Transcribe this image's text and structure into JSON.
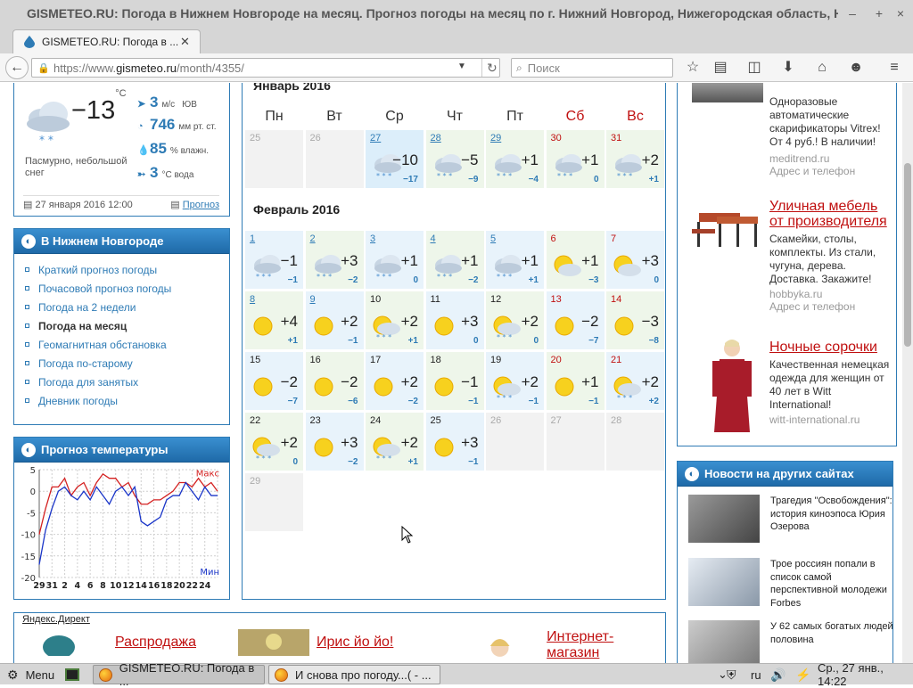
{
  "window": {
    "title": "GISMETEO.RU: Погода в Нижнем Новгороде на месяц. Прогноз погоды на месяц по г. Нижний Новгород, Нижегородская область, Н"
  },
  "tab": {
    "label": "GISMETEO.RU: Погода в ..."
  },
  "url": {
    "prefix": "https://www.",
    "host": "gismeteo.ru",
    "path": "/month/4355/"
  },
  "search": {
    "placeholder": "Поиск"
  },
  "current": {
    "temp": "−13",
    "temp_unit": "°C",
    "condition": "Пасмурно, небольшой снег",
    "wind_value": "3",
    "wind_unit": "м/с",
    "wind_dir": "ЮВ",
    "pressure_value": "746",
    "pressure_unit": "мм рт. ст.",
    "humidity_value": "85",
    "humidity_unit": "% влажн.",
    "water_value": "3",
    "water_unit": "°C вода",
    "date": "27 января 2016 12:00",
    "forecast_link": "Прогноз"
  },
  "city_nav": {
    "title": "В Нижнем Новгороде",
    "items": [
      {
        "label": "Краткий прогноз погоды"
      },
      {
        "label": "Почасовой прогноз погоды"
      },
      {
        "label": "Погода на 2 недели"
      },
      {
        "label": "Погода на месяц"
      },
      {
        "label": "Геомагнитная обстановка"
      },
      {
        "label": "Погода по-старому"
      },
      {
        "label": "Погода для занятых"
      },
      {
        "label": "Дневник погоды"
      }
    ]
  },
  "temp_chart": {
    "title": "Прогноз температуры",
    "max_label": "Макс",
    "min_label": "Мин",
    "chart_data": {
      "type": "line",
      "x": [
        "29",
        "31",
        "2",
        "4",
        "6",
        "8",
        "10",
        "12",
        "14",
        "16",
        "18",
        "20",
        "22",
        "24"
      ],
      "ylim": [
        -20,
        5
      ],
      "yticks": [
        5,
        0,
        -5,
        -10,
        -15,
        -20
      ],
      "series": [
        {
          "name": "Макс",
          "color": "#d42020",
          "values": [
            -10,
            -4,
            1,
            1,
            3,
            -1,
            1,
            2,
            -1,
            2,
            4,
            3,
            3,
            1,
            2,
            -1,
            -3,
            -3,
            -2,
            -2,
            -1,
            0,
            2,
            2,
            1,
            3,
            1,
            2,
            0
          ]
        },
        {
          "name": "Мин",
          "color": "#1a35c8",
          "values": [
            -17,
            -9,
            -4,
            0,
            1,
            -1,
            -2,
            0,
            -2,
            1,
            -1,
            -3,
            0,
            1,
            -1,
            1,
            -7,
            -8,
            -7,
            -6,
            -2,
            -1,
            -1,
            2,
            0,
            -2,
            1,
            -1,
            -1
          ]
        }
      ]
    }
  },
  "calendar": {
    "jan_title": "Январь 2016",
    "feb_title": "Февраль 2016",
    "dow": [
      "Пн",
      "Вт",
      "Ср",
      "Чт",
      "Пт",
      "Сб",
      "Вс"
    ],
    "jan_days": [
      {
        "d": "25",
        "t": "",
        "n": "",
        "icon": "none",
        "empty": true
      },
      {
        "d": "26",
        "t": "",
        "n": "",
        "icon": "none",
        "empty": true
      },
      {
        "d": "27",
        "t": "−10",
        "n": "−17",
        "icon": "cloud-snow"
      },
      {
        "d": "28",
        "t": "−5",
        "n": "−9",
        "icon": "cloud-snow"
      },
      {
        "d": "29",
        "t": "+1",
        "n": "−4",
        "icon": "cloud-snow"
      },
      {
        "d": "30",
        "t": "+1",
        "n": "0",
        "icon": "cloud-snow"
      },
      {
        "d": "31",
        "t": "+2",
        "n": "+1",
        "icon": "cloud-snow"
      }
    ],
    "feb_days": [
      {
        "d": "1",
        "t": "−1",
        "n": "−1",
        "icon": "cloud-snow"
      },
      {
        "d": "2",
        "t": "+3",
        "n": "−2",
        "icon": "cloud-snow"
      },
      {
        "d": "3",
        "t": "+1",
        "n": "0",
        "icon": "cloud-snow"
      },
      {
        "d": "4",
        "t": "+1",
        "n": "−2",
        "icon": "cloud-snow"
      },
      {
        "d": "5",
        "t": "+1",
        "n": "+1",
        "icon": "cloud-snow"
      },
      {
        "d": "6",
        "t": "+1",
        "n": "−3",
        "icon": "sun-cloud"
      },
      {
        "d": "7",
        "t": "+3",
        "n": "0",
        "icon": "sun-cloud"
      },
      {
        "d": "8",
        "t": "+4",
        "n": "+1",
        "icon": "sun"
      },
      {
        "d": "9",
        "t": "+2",
        "n": "−1",
        "icon": "sun"
      },
      {
        "d": "10",
        "t": "+2",
        "n": "+1",
        "icon": "sun-cloud-snow"
      },
      {
        "d": "11",
        "t": "+3",
        "n": "0",
        "icon": "sun"
      },
      {
        "d": "12",
        "t": "+2",
        "n": "0",
        "icon": "sun-cloud-snow"
      },
      {
        "d": "13",
        "t": "−2",
        "n": "−7",
        "icon": "sun"
      },
      {
        "d": "14",
        "t": "−3",
        "n": "−8",
        "icon": "sun"
      },
      {
        "d": "15",
        "t": "−2",
        "n": "−7",
        "icon": "sun"
      },
      {
        "d": "16",
        "t": "−2",
        "n": "−6",
        "icon": "sun"
      },
      {
        "d": "17",
        "t": "+2",
        "n": "−2",
        "icon": "sun"
      },
      {
        "d": "18",
        "t": "−1",
        "n": "−1",
        "icon": "sun"
      },
      {
        "d": "19",
        "t": "+2",
        "n": "−1",
        "icon": "sun-cloud-snow"
      },
      {
        "d": "20",
        "t": "+1",
        "n": "−1",
        "icon": "sun"
      },
      {
        "d": "21",
        "t": "+2",
        "n": "+2",
        "icon": "sun-cloud-snow"
      },
      {
        "d": "22",
        "t": "+2",
        "n": "0",
        "icon": "sun-cloud-snow"
      },
      {
        "d": "23",
        "t": "+3",
        "n": "−2",
        "icon": "sun"
      },
      {
        "d": "24",
        "t": "+2",
        "n": "+1",
        "icon": "sun-cloud-snow"
      },
      {
        "d": "25",
        "t": "+3",
        "n": "−1",
        "icon": "sun"
      },
      {
        "d": "26",
        "t": "",
        "n": "",
        "icon": "none",
        "empty": true
      },
      {
        "d": "27",
        "t": "",
        "n": "",
        "icon": "none",
        "empty": true
      },
      {
        "d": "28",
        "t": "",
        "n": "",
        "icon": "none",
        "empty": true
      },
      {
        "d": "29",
        "t": "",
        "n": "",
        "icon": "none",
        "empty": true
      }
    ]
  },
  "ads": [
    {
      "title": "",
      "text": "Одноразовые автоматические скарификаторы Vitrex! От 4 руб.! В наличии!",
      "domain": "meditrend.ru",
      "address": "Адрес и телефон"
    },
    {
      "title": "Уличная мебель от производителя",
      "text": "Скамейки, столы, комплекты. Из стали, чугуна, дерева. Доставка. Закажите!",
      "domain": "hobbyka.ru",
      "address": "Адрес и телефон"
    },
    {
      "title": "Ночные сорочки",
      "text": "Качественная немецкая одежда для женщин от 40 лет в Witt International!",
      "domain": "witt-international.ru",
      "address": ""
    }
  ],
  "news": {
    "title": "Новости на других сайтах",
    "items": [
      {
        "text": "Трагедия \"Освобождения\": история киноэпоса Юрия Озерова"
      },
      {
        "text": "Трое россиян попали в список самой перспективной молодежи Forbes"
      },
      {
        "text": "У 62 самых богатых людей половина"
      }
    ]
  },
  "direct": {
    "label": "Яндекс.Директ",
    "items": [
      {
        "title": "Распродажа"
      },
      {
        "title": "Ирис йо йо!"
      },
      {
        "title": "Интернет-магазин"
      }
    ]
  },
  "taskbar": {
    "menu": "Menu",
    "windows": [
      {
        "label": "GISMETEO.RU: Погода в ..."
      },
      {
        "label": "И снова про погоду...( - ..."
      }
    ],
    "lang": "ru",
    "clock": "Ср., 27 янв., 14:22"
  }
}
